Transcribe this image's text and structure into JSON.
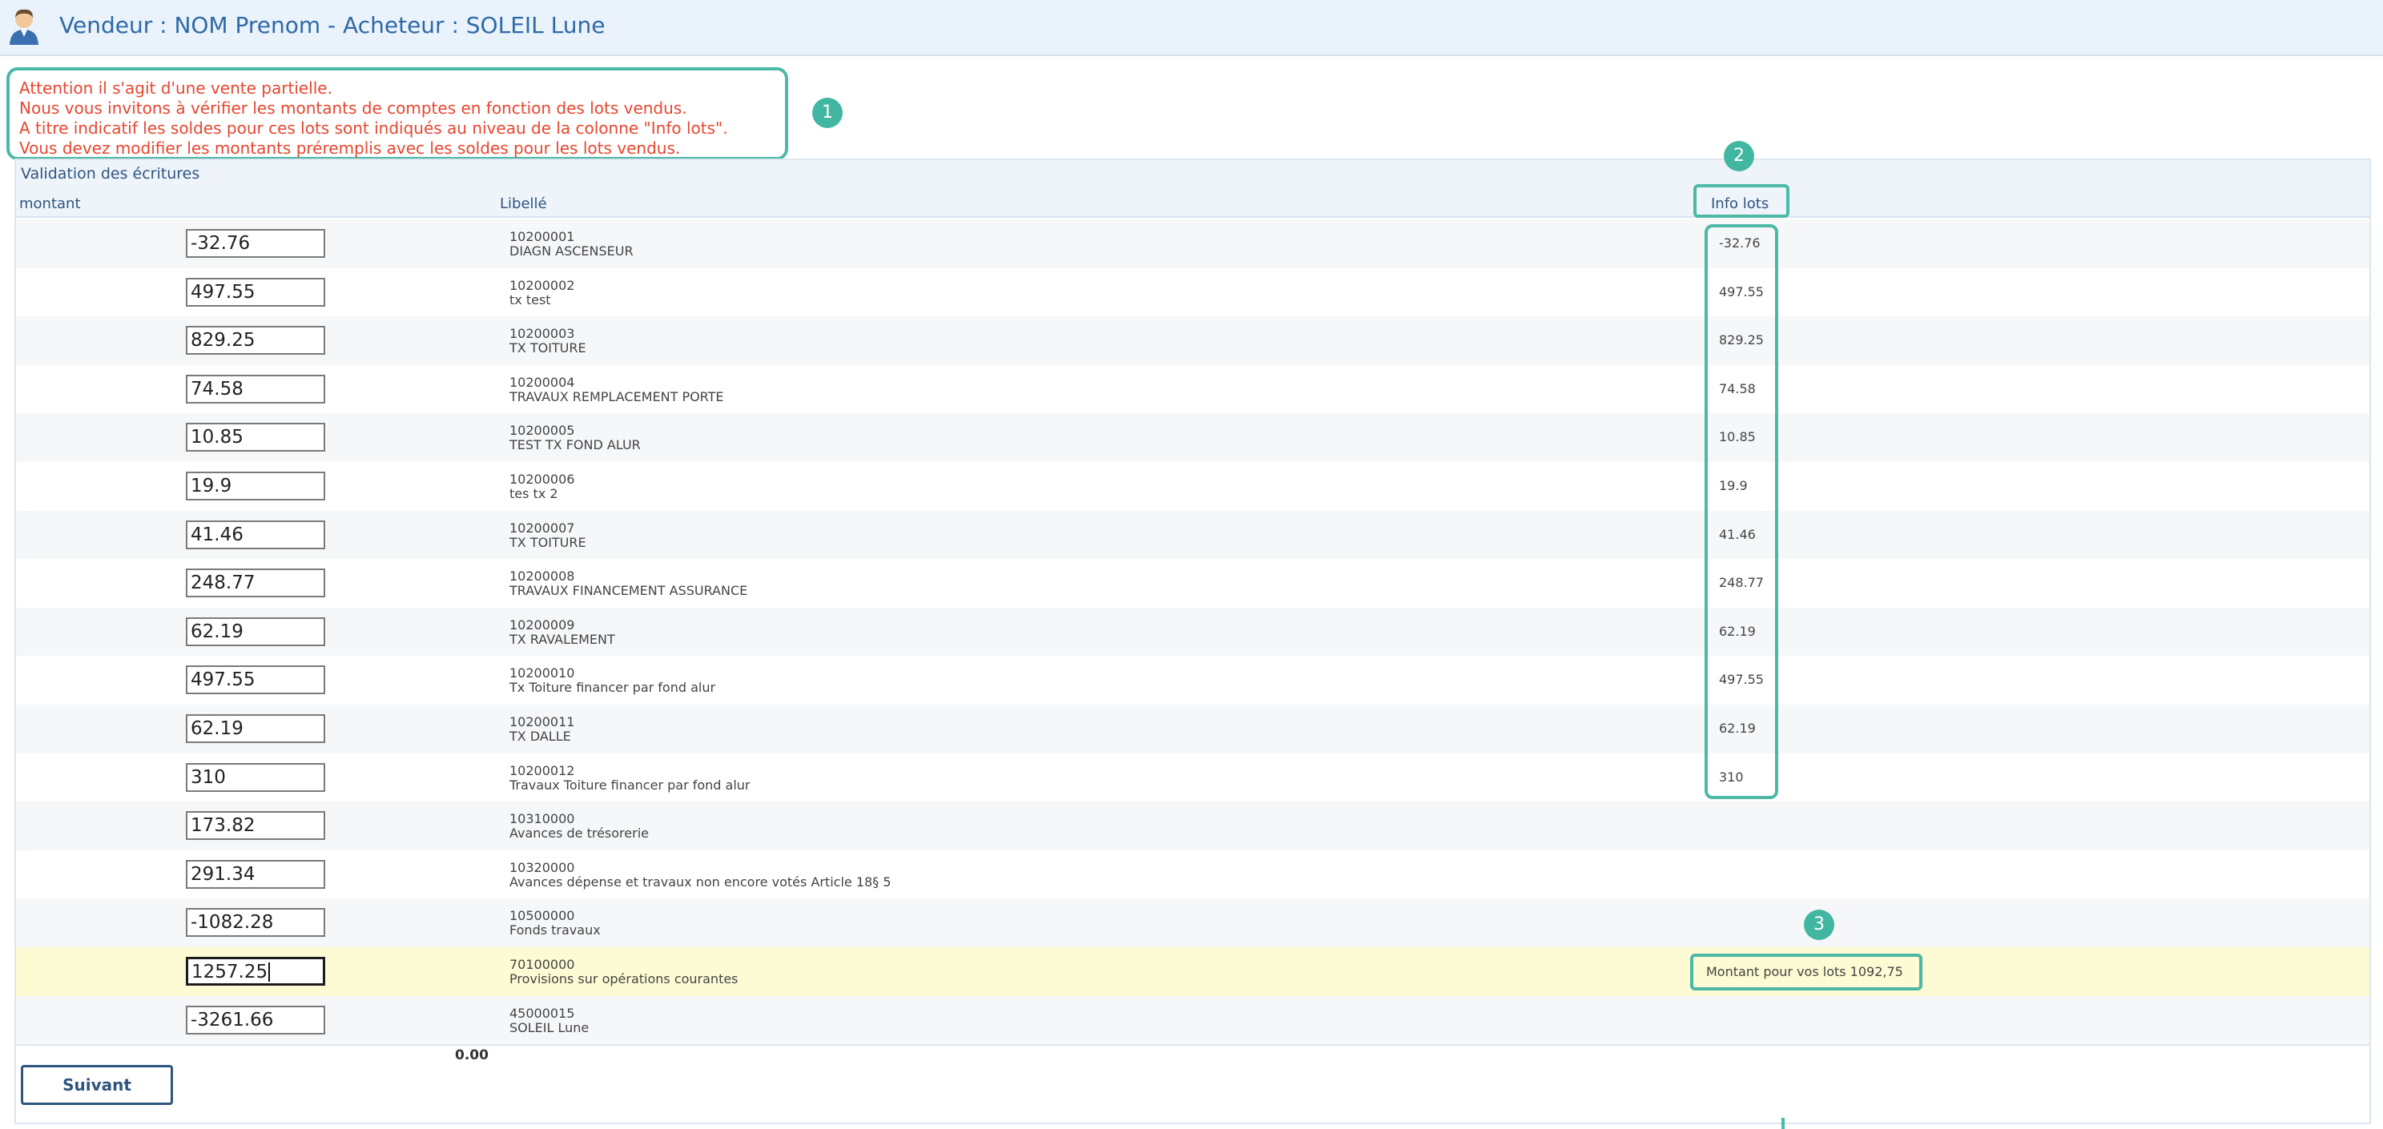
{
  "header": {
    "title": "Vendeur : NOM Prenom - Acheteur : SOLEIL Lune"
  },
  "warning": {
    "lines": [
      "Attention il s'agit d'une vente partielle.",
      "Nous vous invitons à vérifier les montants de comptes en fonction des lots vendus.",
      "A titre indicatif les soldes pour ces lots sont indiqués au niveau de la colonne \"Info lots\".",
      "Vous devez modifier les montants préremplis avec les soldes pour les lots vendus."
    ]
  },
  "badges": [
    "1",
    "2",
    "3"
  ],
  "panel": {
    "title": "Validation des écritures",
    "columns": {
      "montant": "montant",
      "libelle": "Libellé",
      "info": "Info lots"
    }
  },
  "rows": [
    {
      "amount": "-32.76",
      "code": "10200001",
      "name": "DIAGN ASCENSEUR",
      "info": "-32.76"
    },
    {
      "amount": "497.55",
      "code": "10200002",
      "name": "tx test",
      "info": "497.55"
    },
    {
      "amount": "829.25",
      "code": "10200003",
      "name": "TX TOITURE",
      "info": "829.25"
    },
    {
      "amount": "74.58",
      "code": "10200004",
      "name": "TRAVAUX REMPLACEMENT PORTE",
      "info": "74.58"
    },
    {
      "amount": "10.85",
      "code": "10200005",
      "name": "TEST TX FOND ALUR",
      "info": "10.85"
    },
    {
      "amount": "19.9",
      "code": "10200006",
      "name": "tes tx 2",
      "info": "19.9"
    },
    {
      "amount": "41.46",
      "code": "10200007",
      "name": "TX TOITURE",
      "info": "41.46"
    },
    {
      "amount": "248.77",
      "code": "10200008",
      "name": "TRAVAUX FINANCEMENT ASSURANCE",
      "info": "248.77"
    },
    {
      "amount": "62.19",
      "code": "10200009",
      "name": "TX RAVALEMENT",
      "info": "62.19"
    },
    {
      "amount": "497.55",
      "code": "10200010",
      "name": "Tx Toiture financer par fond alur",
      "info": "497.55"
    },
    {
      "amount": "62.19",
      "code": "10200011",
      "name": "TX DALLE",
      "info": "62.19"
    },
    {
      "amount": "310",
      "code": "10200012",
      "name": "Travaux Toiture financer par fond alur",
      "info": "310"
    },
    {
      "amount": "173.82",
      "code": "10310000",
      "name": "Avances de trésorerie",
      "info": ""
    },
    {
      "amount": "291.34",
      "code": "10320000",
      "name": "Avances dépense et travaux non encore votés Article 18§ 5",
      "info": ""
    },
    {
      "amount": "-1082.28",
      "code": "10500000",
      "name": "Fonds travaux",
      "info": ""
    },
    {
      "amount": "1257.25",
      "code": "70100000",
      "name": "Provisions sur opérations courantes",
      "info": "",
      "note": "Montant pour vos lots 1092,75"
    },
    {
      "amount": "-3261.66",
      "code": "45000015",
      "name": "SOLEIL Lune",
      "info": ""
    }
  ],
  "total": "0.00",
  "buttons": {
    "next": "Suivant"
  },
  "colors": {
    "accent": "#4cb8a6",
    "warning_text": "#e8462f",
    "title_blue": "#2e6aa8",
    "highlight_row": "#fdfbd3"
  }
}
